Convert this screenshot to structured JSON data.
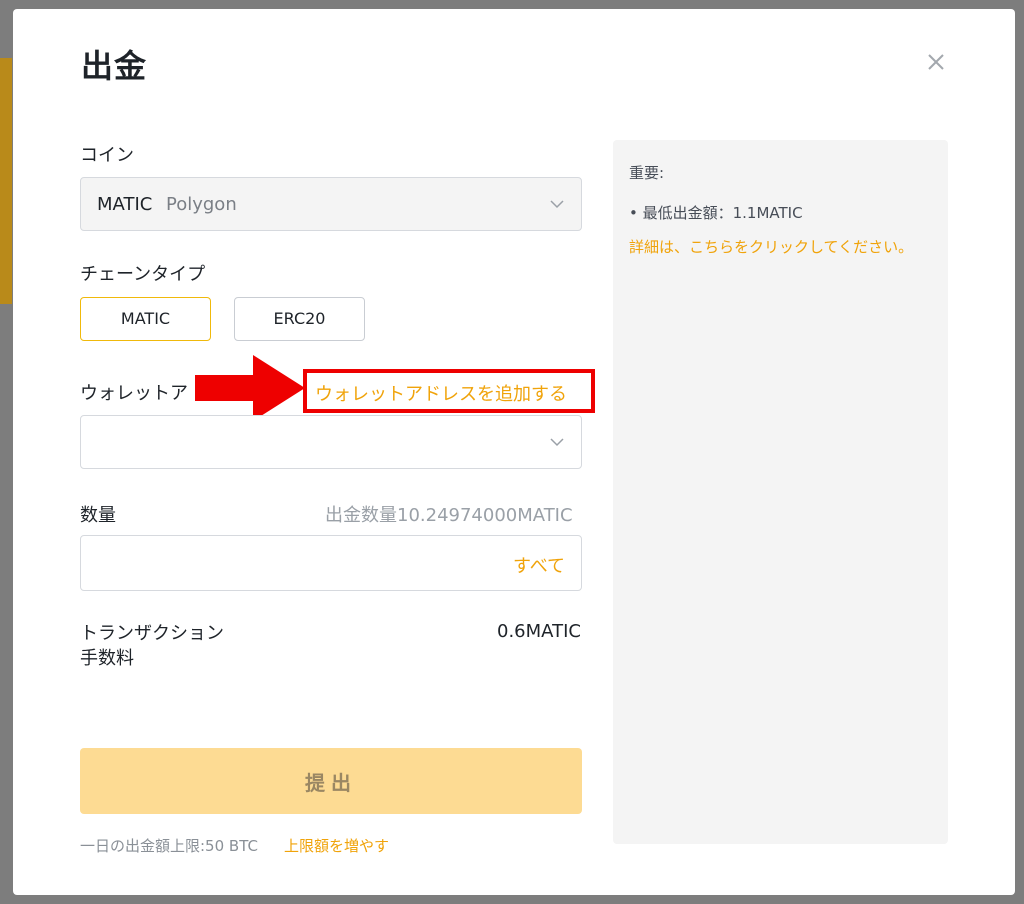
{
  "modal": {
    "title": "出金"
  },
  "coin": {
    "label": "コイン",
    "symbol": "MATIC",
    "name": "Polygon"
  },
  "chain": {
    "label": "チェーンタイプ",
    "options": [
      {
        "label": "MATIC",
        "selected": true
      },
      {
        "label": "ERC20",
        "selected": false
      }
    ]
  },
  "wallet": {
    "label": "ウォレットア",
    "add_link": "ウォレットアドレスを追加する",
    "value": ""
  },
  "amount": {
    "label": "数量",
    "available": "出金数量10.24974000MATIC",
    "value": "",
    "all_label": "すべて"
  },
  "fee": {
    "label_line1": "トランザクション",
    "label_line2": "手数料",
    "value": "0.6MATIC"
  },
  "submit": {
    "label": "提出"
  },
  "limit": {
    "text": "一日の出金額上限:50 BTC",
    "link": "上限額を増やす"
  },
  "info": {
    "title": "重要:",
    "item": "• 最低出金額：1.1MATIC",
    "link": "詳細は、こちらをクリックしてください。"
  },
  "colors": {
    "accent": "#f0b90b",
    "link": "#f0a30a",
    "submit_bg": "#fddb93",
    "highlight_red": "#ee0000",
    "panel_bg": "#f4f4f4"
  }
}
